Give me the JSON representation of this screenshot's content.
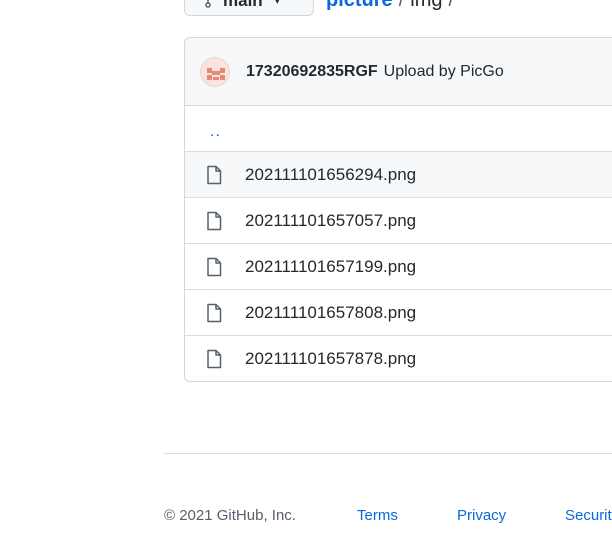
{
  "header": {
    "branch_label": "main",
    "repo_name": "picture",
    "separator": "/",
    "current_dir": "img",
    "trailing_sep": "/"
  },
  "commit": {
    "author": "17320692835RGF",
    "message": "Upload by PicGo"
  },
  "up_dir": "..",
  "files": [
    {
      "name": "202111101656294.png"
    },
    {
      "name": "202111101657057.png"
    },
    {
      "name": "202111101657199.png"
    },
    {
      "name": "202111101657808.png"
    },
    {
      "name": "202111101657878.png"
    }
  ],
  "footer": {
    "copyright": "© 2021 GitHub, Inc.",
    "links": [
      "Terms",
      "Privacy",
      "Security"
    ]
  },
  "colors": {
    "link": "#0969da",
    "border": "#d0d7de",
    "header_bg": "#f6f8fa"
  }
}
